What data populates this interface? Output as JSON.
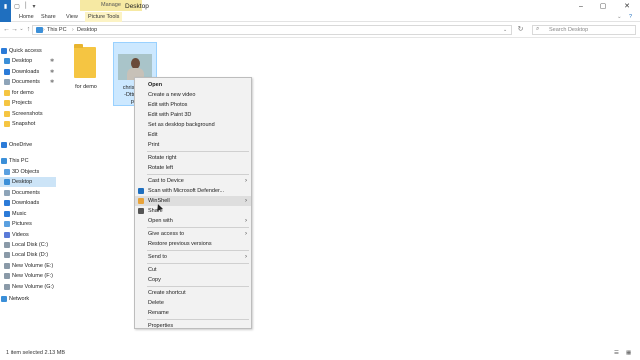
{
  "window": {
    "title": "Desktop",
    "manage_tab": "Manage"
  },
  "ribbon": {
    "tabs": [
      "Home",
      "Share",
      "View",
      "Picture Tools"
    ]
  },
  "addressbar": {
    "path": [
      "This PC",
      "Desktop"
    ],
    "search_placeholder": "Search Desktop"
  },
  "navpane": {
    "items": [
      {
        "label": "Quick access",
        "icon": "star-icon",
        "color": "#2b7bd8",
        "pinned": false
      },
      {
        "label": "Desktop",
        "icon": "desktop-icon",
        "color": "#3b8fd8",
        "pinned": true
      },
      {
        "label": "Downloads",
        "icon": "download-icon",
        "color": "#2b7bd8",
        "pinned": true
      },
      {
        "label": "Documents",
        "icon": "documents-icon",
        "color": "#8ea4b8",
        "pinned": true
      },
      {
        "label": "for demo",
        "icon": "folder-icon",
        "color": "#f5c542",
        "pinned": false
      },
      {
        "label": "Projects",
        "icon": "folder-icon",
        "color": "#f5c542",
        "pinned": false
      },
      {
        "label": "Screenshots",
        "icon": "folder-icon",
        "color": "#f5c542",
        "pinned": false
      },
      {
        "label": "Snapshot",
        "icon": "folder-icon",
        "color": "#f5c542",
        "pinned": false
      },
      {
        "label": "OneDrive",
        "icon": "cloud-icon",
        "color": "#2b7bd8",
        "pinned": false
      },
      {
        "label": "This PC",
        "icon": "pc-icon",
        "color": "#3b8fd8",
        "pinned": false
      },
      {
        "label": "3D Objects",
        "icon": "cube-icon",
        "color": "#5aa0e0",
        "pinned": false
      },
      {
        "label": "Desktop",
        "icon": "desktop-icon",
        "color": "#3b8fd8",
        "pinned": false,
        "selected": true
      },
      {
        "label": "Documents",
        "icon": "documents-icon",
        "color": "#8ea4b8",
        "pinned": false
      },
      {
        "label": "Downloads",
        "icon": "download-icon",
        "color": "#2b7bd8",
        "pinned": false
      },
      {
        "label": "Music",
        "icon": "music-icon",
        "color": "#2b7bd8",
        "pinned": false
      },
      {
        "label": "Pictures",
        "icon": "pictures-icon",
        "color": "#5aa0e0",
        "pinned": false
      },
      {
        "label": "Videos",
        "icon": "videos-icon",
        "color": "#5a7bd8",
        "pinned": false
      },
      {
        "label": "Local Disk (C:)",
        "icon": "disk-icon",
        "color": "#8a9aa8",
        "pinned": false
      },
      {
        "label": "Local Disk (D:)",
        "icon": "disk-icon",
        "color": "#8a9aa8",
        "pinned": false
      },
      {
        "label": "New Volume (E:)",
        "icon": "disk-icon",
        "color": "#8a9aa8",
        "pinned": false
      },
      {
        "label": "New Volume (F:)",
        "icon": "disk-icon",
        "color": "#8a9aa8",
        "pinned": false
      },
      {
        "label": "New Volume (G:)",
        "icon": "disk-icon",
        "color": "#8a9aa8",
        "pinned": false
      },
      {
        "label": "Network",
        "icon": "network-icon",
        "color": "#3b8fd8",
        "pinned": false
      }
    ]
  },
  "files": {
    "folder": {
      "label": "for demo"
    },
    "image": {
      "label_lines": [
        "christian",
        "-Dttrich",
        "pl"
      ]
    }
  },
  "context_menu": {
    "items": [
      {
        "label": "Open",
        "bold": true
      },
      {
        "label": "Create a new video"
      },
      {
        "label": "Edit with Photos"
      },
      {
        "label": "Edit with Paint 3D"
      },
      {
        "label": "Set as desktop background"
      },
      {
        "label": "Edit"
      },
      {
        "label": "Print"
      },
      {
        "sep": true
      },
      {
        "label": "Rotate right"
      },
      {
        "label": "Rotate left"
      },
      {
        "sep": true
      },
      {
        "label": "Cast to Device",
        "submenu": true
      },
      {
        "label": "Scan with Microsoft Defender...",
        "icon": "defender-icon",
        "icon_color": "#1f6fbf"
      },
      {
        "label": "WinShell",
        "submenu": true,
        "icon": "winshell-icon",
        "icon_color": "#e8a33a",
        "highlight": true
      },
      {
        "label": "Share",
        "icon": "share-icon",
        "icon_color": "#555"
      },
      {
        "label": "Open with",
        "submenu": true
      },
      {
        "sep": true
      },
      {
        "label": "Give access to",
        "submenu": true
      },
      {
        "label": "Restore previous versions"
      },
      {
        "sep": true
      },
      {
        "label": "Send to",
        "submenu": true
      },
      {
        "sep": true
      },
      {
        "label": "Cut"
      },
      {
        "label": "Copy"
      },
      {
        "sep": true
      },
      {
        "label": "Create shortcut"
      },
      {
        "label": "Delete"
      },
      {
        "label": "Rename"
      },
      {
        "sep": true
      },
      {
        "label": "Properties"
      }
    ]
  },
  "statusbar": {
    "selection": "1 item selected  2.13 MB"
  }
}
